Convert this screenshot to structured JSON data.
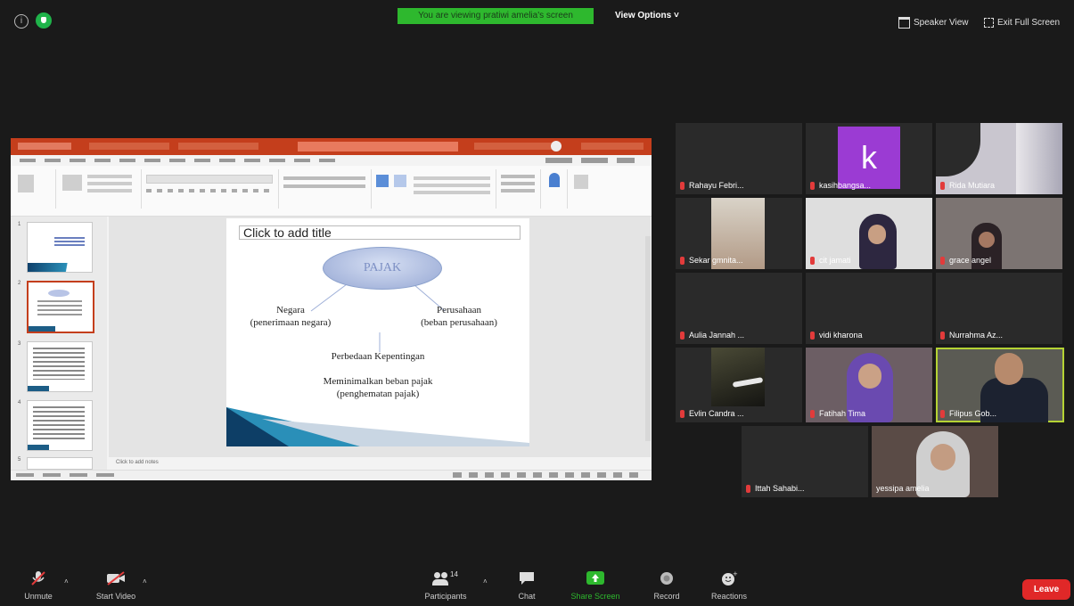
{
  "top": {
    "banner": "You are viewing pratiwi amelia's screen",
    "view_options": "View Options ˅",
    "speaker_view": "Speaker View",
    "exit_full_screen": "Exit Full Screen"
  },
  "slide": {
    "title_placeholder": "Click to add title",
    "oval_text": "PAJAK",
    "left_text_1": "Negara",
    "left_text_2": "(penerimaan negara)",
    "right_text_1": "Perusahaan",
    "right_text_2": "(beban perusahaan)",
    "center_1": "Perbedaan Kepentingan",
    "center_2": "Meminimalkan beban pajak",
    "center_3": "(penghematan pajak)",
    "notes": "Click to add notes"
  },
  "participants": [
    {
      "name": "Rahayu Febri...",
      "avatar": ""
    },
    {
      "name": "kasihbangsa...",
      "avatar": "k"
    },
    {
      "name": "Rida Mutiara",
      "avatar": ""
    },
    {
      "name": "Sekar gmnita...",
      "avatar": ""
    },
    {
      "name": "cit jamati",
      "avatar": ""
    },
    {
      "name": "grace angel",
      "avatar": ""
    },
    {
      "name": "Aulia Jannah ...",
      "avatar": ""
    },
    {
      "name": "vidi kharona",
      "avatar": ""
    },
    {
      "name": "Nurrahma Az...",
      "avatar": ""
    },
    {
      "name": "Evlin Candra ...",
      "avatar": ""
    },
    {
      "name": "Fatihah Tima",
      "avatar": ""
    },
    {
      "name": "Filipus Gob...",
      "avatar": ""
    },
    {
      "name": "Ittah Sahabi...",
      "avatar": ""
    },
    {
      "name": "yessipa amelia",
      "avatar": ""
    }
  ],
  "toolbar": {
    "unmute": "Unmute",
    "start_video": "Start Video",
    "participants": "Participants",
    "participant_count": "14",
    "chat": "Chat",
    "share_screen": "Share Screen",
    "record": "Record",
    "reactions": "Reactions",
    "leave": "Leave"
  },
  "colors": {
    "banner": "#2eb82e",
    "ppt_accent": "#c43e1c",
    "active_speaker": "#b5d334",
    "leave": "#e02828",
    "share": "#2eb82e"
  }
}
